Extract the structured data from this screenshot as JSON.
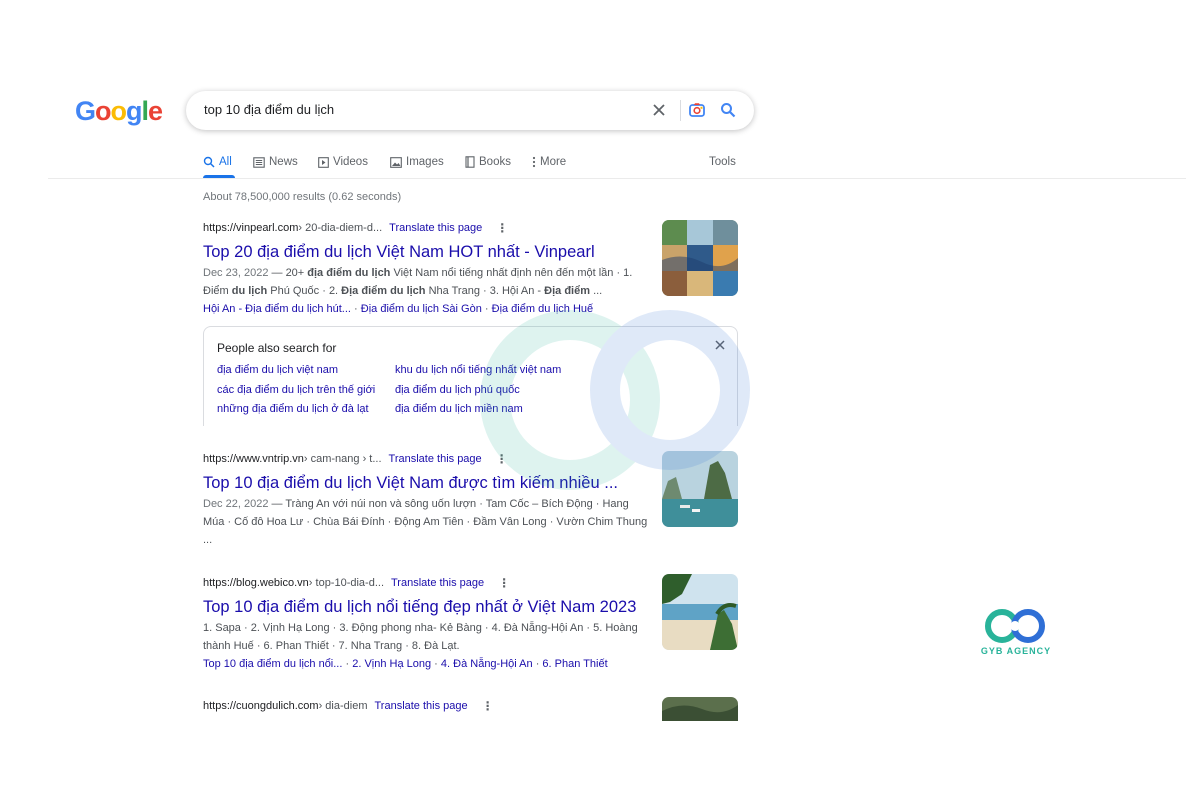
{
  "logo": {
    "letters": [
      "G",
      "o",
      "o",
      "g",
      "l",
      "e"
    ],
    "colors": [
      "#4285f4",
      "#ea4335",
      "#fbbc05",
      "#4285f4",
      "#34a853",
      "#ea4335"
    ]
  },
  "search": {
    "query": "top 10 địa điểm du lịch"
  },
  "tabs": [
    {
      "label": "All",
      "icon": "search-icon",
      "active": true
    },
    {
      "label": "News",
      "icon": "news-icon"
    },
    {
      "label": "Videos",
      "icon": "play-icon"
    },
    {
      "label": "Images",
      "icon": "image-icon"
    },
    {
      "label": "Books",
      "icon": "book-icon"
    },
    {
      "label": "More",
      "icon": "more-vert-icon"
    }
  ],
  "tools_label": "Tools",
  "stats": "About 78,500,000 results (0.62 seconds)",
  "results": [
    {
      "url": "https://vinpearl.com",
      "path": " › 20-dia-diem-d...",
      "translate": "Translate this page",
      "title": "Top 20 địa điểm du lịch Việt Nam HOT nhất - Vinpearl",
      "date": "Dec 23, 2022",
      "snippet_parts": [
        "20+ ",
        "địa điểm du lịch",
        " Việt Nam nổi tiếng nhất định nên đến một lần · 1. Điểm ",
        "du lịch",
        " Phú Quốc · 2. ",
        "Địa điểm du lịch",
        " Nha Trang · 3. Hội An - ",
        "Địa điểm",
        " ..."
      ],
      "sitelinks": [
        "Hội An - Địa điểm du lịch hút...",
        "Địa điểm du lịch Sài Gòn",
        "Địa điểm du lịch Huế"
      ]
    },
    {
      "url": "https://www.vntrip.vn",
      "path": " › cam-nang › t...",
      "translate": "Translate this page",
      "title": "Top 10 địa điểm du lịch Việt Nam được tìm kiếm nhiều ...",
      "date": "Dec 22, 2022",
      "snippet": "Tràng An với núi non và sông uốn lượn · Tam Cốc – Bích Động · Hang Múa · Cố đô Hoa Lư · Chùa Bái Đính · Động Am Tiên · Đầm Vân Long · Vườn Chim Thung ..."
    },
    {
      "url": "https://blog.webico.vn",
      "path": " › top-10-dia-d...",
      "translate": "Translate this page",
      "title": "Top 10 địa điểm du lịch nổi tiếng đẹp nhất ở Việt Nam 2023",
      "snippet": "1. Sapa · 2. Vịnh Hạ Long · 3. Động phong nha- Kẻ Bàng · 4. Đà Nẵng-Hội An · 5. Hoàng thành Huế · 6. Phan Thiết · 7. Nha Trang · 8. Đà Lạt.",
      "sitelinks": [
        "Top 10 địa điểm du lịch nổi...",
        "2. Vịnh Hạ Long",
        "4. Đà Nẵng-Hội An",
        "6. Phan Thiết"
      ]
    },
    {
      "url": "https://cuongdulich.com",
      "path": " › dia-diem",
      "translate": "Translate this page"
    }
  ],
  "people_also_search": {
    "title": "People also search for",
    "links": [
      "địa điểm du lịch việt nam",
      "khu du lịch nổi tiếng nhất việt nam",
      "các địa điểm du lịch trên thế giới",
      "địa điểm du lịch phú quốc",
      "những địa điểm du lịch ở đà lạt",
      "địa điểm du lịch miền nam"
    ]
  },
  "brand": {
    "name": "GYB AGENCY",
    "colors": [
      "#29b39a",
      "#2f6fd6"
    ]
  }
}
